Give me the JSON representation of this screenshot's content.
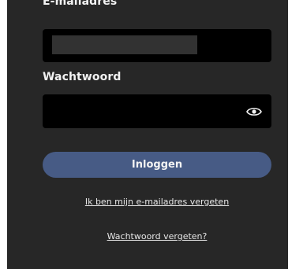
{
  "form": {
    "email_label": "E-mailadres",
    "email_value": "",
    "password_label": "Wachtwoord",
    "password_value": "",
    "show_password_icon": "eye-icon",
    "login_button_label": "Inloggen",
    "forgot_email_link": "Ik ben mijn e-mailadres vergeten",
    "forgot_password_link": "Wachtwoord vergeten?"
  },
  "colors": {
    "panel_background": "#272727",
    "field_background": "#000000",
    "button_background": "#475b85",
    "text": "#f2f2f2"
  }
}
